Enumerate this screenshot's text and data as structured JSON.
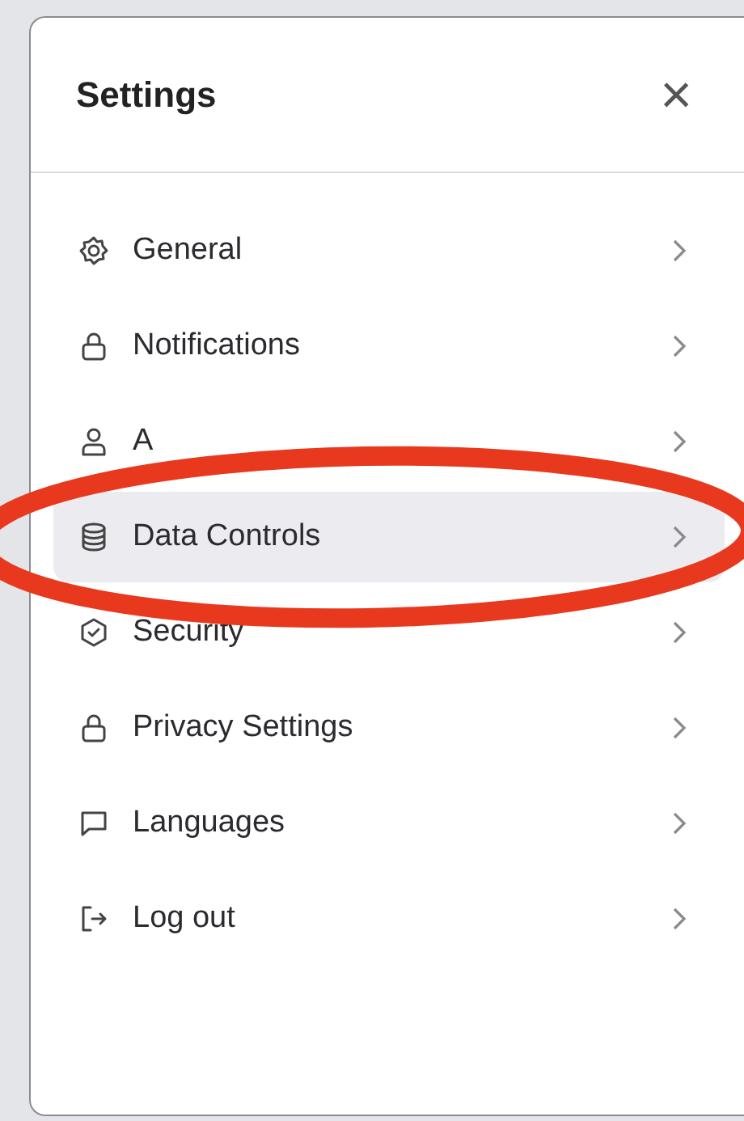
{
  "panel": {
    "title": "Settings",
    "close": "×"
  },
  "items": [
    {
      "label": "General",
      "selected": false
    },
    {
      "label": "Notifications",
      "selected": false
    },
    {
      "label": "A",
      "selected": false
    },
    {
      "label": "Data Controls",
      "selected": true
    },
    {
      "label": "Security",
      "selected": false
    },
    {
      "label": "Privacy Settings",
      "selected": false
    },
    {
      "label": "Languages",
      "selected": false
    },
    {
      "label": "Log out",
      "selected": false
    }
  ],
  "annotation": {
    "kind": "ellipse"
  }
}
